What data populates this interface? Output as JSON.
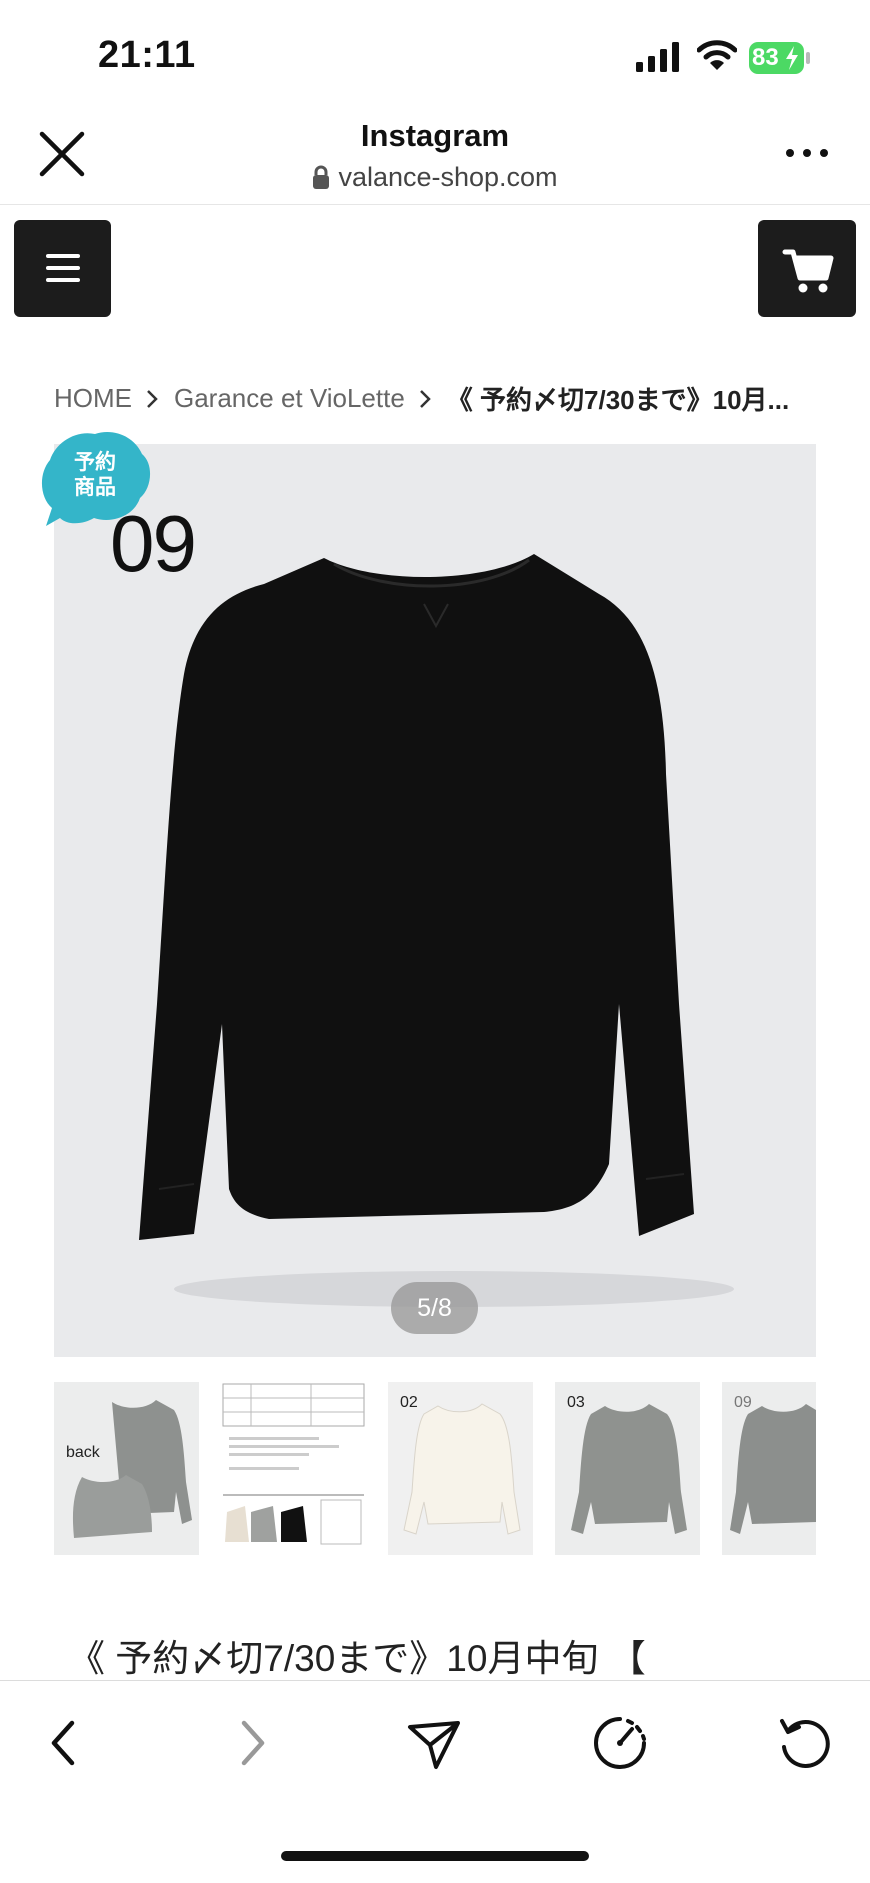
{
  "status_bar": {
    "time": "21:11",
    "battery": "83"
  },
  "browser": {
    "title": "Instagram",
    "url": "valance-shop.com"
  },
  "breadcrumb": {
    "home": "HOME",
    "category": "Garance et VioLette",
    "current": "《 予約〆切7/30まで》10月..."
  },
  "product_image": {
    "badge_line1": "予約",
    "badge_line2": "商品",
    "number": "09",
    "pager": "5/8"
  },
  "thumbnails": [
    {
      "label": "back"
    },
    {
      "label": ""
    },
    {
      "label": "02"
    },
    {
      "label": "03"
    },
    {
      "label": "09"
    }
  ],
  "product": {
    "title": "《 予約〆切7/30まで》10月中旬 【"
  },
  "colors": {
    "badge": "#34b5c9",
    "battery": "#4cd964",
    "nav_button": "#1c1c1c"
  },
  "icons": [
    "close-icon",
    "lock-icon",
    "more-icon",
    "menu-icon",
    "cart-icon",
    "chevron-right-icon",
    "back-arrow-icon",
    "forward-arrow-icon",
    "share-icon",
    "speed-icon",
    "reload-icon"
  ]
}
